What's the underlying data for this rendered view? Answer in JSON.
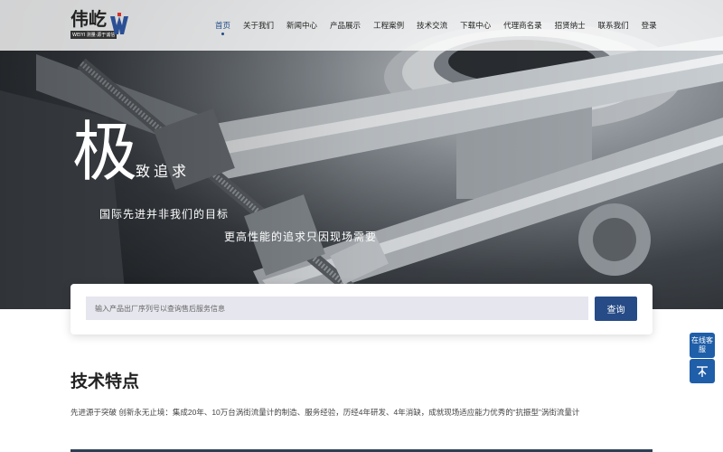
{
  "header": {
    "logo_main": "伟屹",
    "logo_sub": "WEIYI 测量·源于诚信",
    "nav": [
      "首页",
      "关于我们",
      "新闻中心",
      "产品展示",
      "工程案例",
      "技术交流",
      "下载中心",
      "代理商名录",
      "招贤纳士",
      "联系我们",
      "登录"
    ],
    "active_index": 0
  },
  "hero": {
    "big_char": "极",
    "side_text": "致追求",
    "line1": "国际先进并非我们的目标",
    "line2": "更高性能的追求只因现场需要"
  },
  "search": {
    "placeholder": "输入产品出厂序列号以查询售后服务信息",
    "button": "查询"
  },
  "section": {
    "title": "技术特点",
    "desc": "先进源于突破 创新永无止境：集成20年、10万台涡街流量计的制造、服务经验，历经4年研发、4年消缺，成就现场适应能力优秀的“抗振型”涡街流量计"
  },
  "float": {
    "service": "在线客服",
    "top_icon": "arrow-up-icon"
  },
  "colors": {
    "accent": "#264b86",
    "float": "#1f5ea8"
  }
}
